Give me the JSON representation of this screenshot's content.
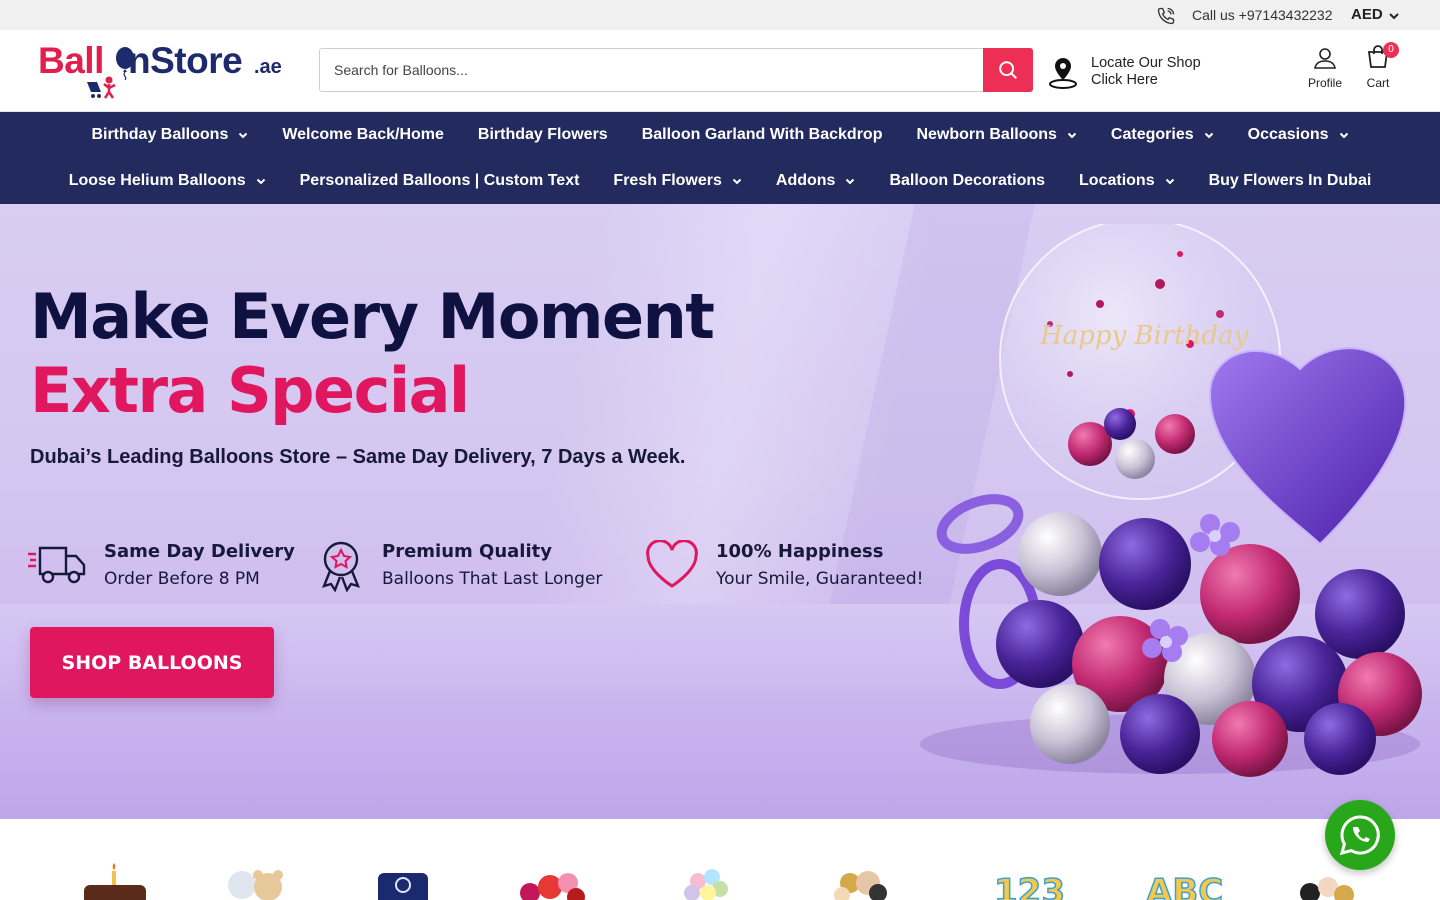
{
  "topbar": {
    "call_text": "Call us +97143432232",
    "currency": "AED"
  },
  "header": {
    "logo": {
      "part1": "Ball",
      "part2": "nStore",
      "suffix": ".ae"
    },
    "search": {
      "placeholder": "Search for Balloons..."
    },
    "locate": {
      "line1": "Locate Our Shop",
      "line2": "Click Here"
    },
    "profile_label": "Profile",
    "cart_label": "Cart",
    "cart_count": "0"
  },
  "nav": {
    "row1": [
      {
        "label": "Birthday Balloons",
        "dropdown": true
      },
      {
        "label": "Welcome Back/Home",
        "dropdown": false
      },
      {
        "label": "Birthday Flowers",
        "dropdown": false
      },
      {
        "label": "Balloon Garland With Backdrop",
        "dropdown": false
      },
      {
        "label": "Newborn Balloons",
        "dropdown": true
      },
      {
        "label": "Categories",
        "dropdown": true
      },
      {
        "label": "Occasions",
        "dropdown": true
      }
    ],
    "row2": [
      {
        "label": "Loose Helium Balloons",
        "dropdown": true
      },
      {
        "label": "Personalized Balloons | Custom Text",
        "dropdown": false
      },
      {
        "label": "Fresh Flowers",
        "dropdown": true
      },
      {
        "label": "Addons",
        "dropdown": true
      },
      {
        "label": "Balloon Decorations",
        "dropdown": false
      },
      {
        "label": "Locations",
        "dropdown": true
      },
      {
        "label": "Buy Flowers In Dubai",
        "dropdown": false
      }
    ]
  },
  "hero": {
    "headline_line1": "Make Every Moment",
    "headline_line2": "Extra Special",
    "tagline": "Dubai’s Leading Balloons Store – Same Day Delivery, 7 Days a Week.",
    "features": [
      {
        "icon": "delivery-truck-icon",
        "title": "Same Day Delivery",
        "subtitle": "Order Before 8 PM"
      },
      {
        "icon": "award-ribbon-icon",
        "title": "Premium Quality",
        "subtitle": "Balloons That Last Longer"
      },
      {
        "icon": "heart-icon",
        "title": "100% Happiness",
        "subtitle": "Your Smile, Guaranteed!"
      }
    ],
    "cta_label": "SHOP BALLOONS",
    "bubble_text": "Happy Birthday"
  },
  "colors": {
    "brand_pink": "#e0175e",
    "nav_bg": "#222a5e",
    "search_btn": "#ee2f55",
    "whatsapp": "#29a71a"
  }
}
